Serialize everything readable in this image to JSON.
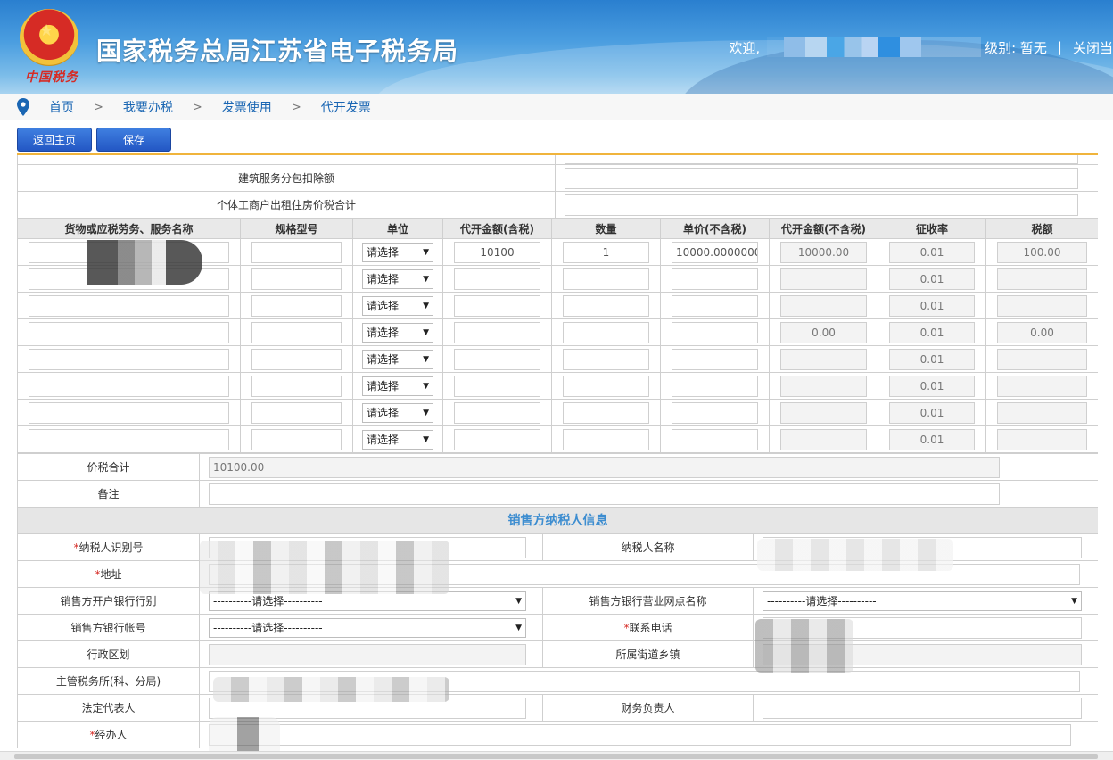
{
  "header": {
    "site_title": "国家税务总局江苏省电子税务局",
    "brand_script": "中国税务",
    "welcome": "欢迎,",
    "level_text": "级别: 暂无",
    "separator": "|",
    "close_text": "关闭当"
  },
  "breadcrumb": {
    "items": [
      "首页",
      "我要办税",
      "发票使用",
      "代开发票"
    ],
    "sep": ">"
  },
  "toolbar": {
    "back_label": "返回主页",
    "save_label": "保存"
  },
  "top_rows": [
    {
      "label": "建筑服务分包扣除额",
      "value": ""
    },
    {
      "label": "个体工商户出租住房价税合计",
      "value": ""
    }
  ],
  "items": {
    "headers": [
      "货物或应税劳务、服务名称",
      "规格型号",
      "单位",
      "代开金额(含税)",
      "数量",
      "单价(不含税)",
      "代开金额(不含税)",
      "征收率",
      "税额"
    ],
    "unit_placeholder": "请选择",
    "rows": [
      {
        "amount": "10100",
        "qty": "1",
        "price": "10000.0000000",
        "amount_ex": "10000.00",
        "rate": "0.01",
        "tax": "100.00"
      },
      {
        "amount": "",
        "qty": "",
        "price": "",
        "amount_ex": "",
        "rate": "0.01",
        "tax": ""
      },
      {
        "amount": "",
        "qty": "",
        "price": "",
        "amount_ex": "",
        "rate": "0.01",
        "tax": ""
      },
      {
        "amount": "",
        "qty": "",
        "price": "",
        "amount_ex": "0.00",
        "rate": "0.01",
        "tax": "0.00"
      },
      {
        "amount": "",
        "qty": "",
        "price": "",
        "amount_ex": "",
        "rate": "0.01",
        "tax": ""
      },
      {
        "amount": "",
        "qty": "",
        "price": "",
        "amount_ex": "",
        "rate": "0.01",
        "tax": ""
      },
      {
        "amount": "",
        "qty": "",
        "price": "",
        "amount_ex": "",
        "rate": "0.01",
        "tax": ""
      },
      {
        "amount": "",
        "qty": "",
        "price": "",
        "amount_ex": "",
        "rate": "0.01",
        "tax": ""
      }
    ]
  },
  "totals": {
    "total_label": "价税合计",
    "total_value": "10100.00",
    "remark_label": "备注",
    "remark_value": ""
  },
  "seller": {
    "section_title": "销售方纳税人信息",
    "required_mark": "*",
    "tax_id_label": "纳税人识别号",
    "name_label": "纳税人名称",
    "address_label": "地址",
    "bank_type_label": "销售方开户银行行别",
    "bank_type_value": "----------请选择----------",
    "branch_label": "销售方银行营业网点名称",
    "branch_value": "----------请选择----------",
    "account_label": "销售方银行帐号",
    "account_value": "----------请选择----------",
    "phone_label": "联系电话",
    "region_label": "行政区划",
    "street_label": "所属街道乡镇",
    "tax_office_label": "主管税务所(科、分局)",
    "legal_rep_label": "法定代表人",
    "finance_label": "财务负责人",
    "handler_label": "经办人"
  }
}
